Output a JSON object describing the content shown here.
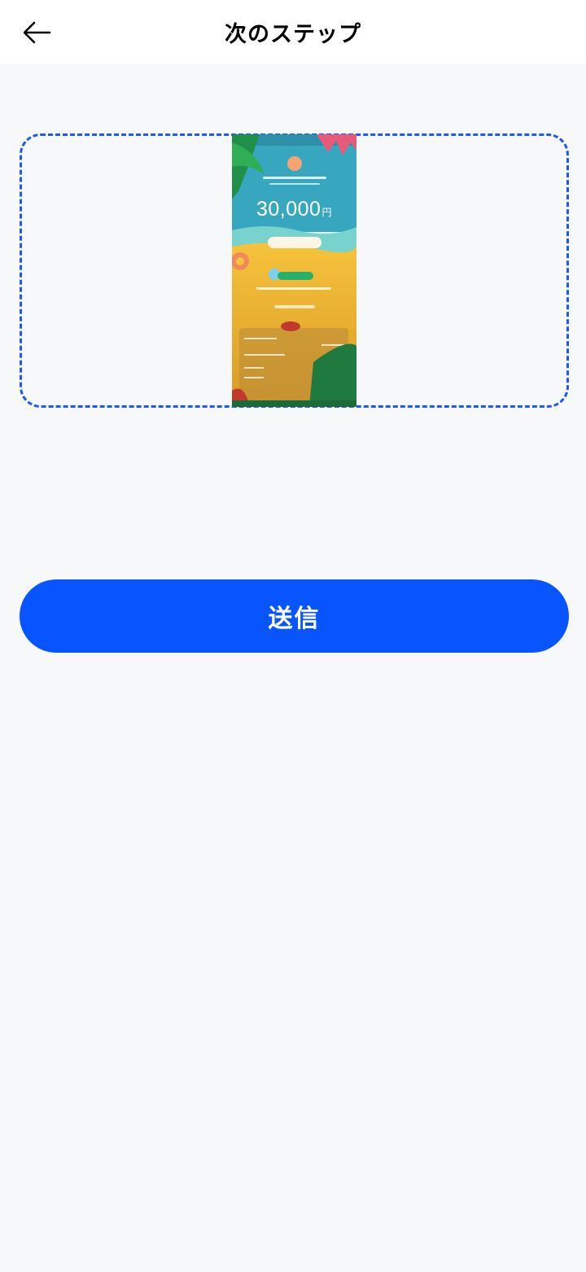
{
  "header": {
    "title": "次のステップ",
    "back_icon": "arrow-left-icon"
  },
  "upload": {
    "preview": {
      "amount": "30,000",
      "currency": "円"
    },
    "accent_color": "#1f5ae8"
  },
  "actions": {
    "send_label": "送信",
    "send_color": "#0855ff"
  }
}
